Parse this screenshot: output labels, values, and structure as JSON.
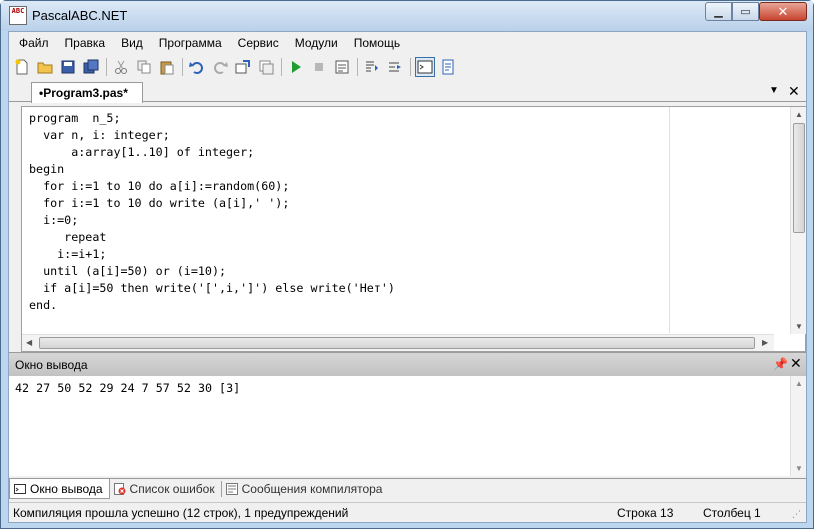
{
  "window": {
    "title": "PascalABC.NET",
    "icon_text": "ABC"
  },
  "menu": [
    "Файл",
    "Правка",
    "Вид",
    "Программа",
    "Сервис",
    "Модули",
    "Помощь"
  ],
  "toolbar": {
    "icons": [
      "new-file-icon",
      "open-folder-icon",
      "save-icon",
      "save-all-icon",
      "cut-icon",
      "copy-icon",
      "paste-icon",
      "undo-icon",
      "redo-icon",
      "find-icon",
      "replace-icon",
      "run-icon",
      "stop-icon",
      "compile-icon",
      "step-into-icon",
      "step-over-icon",
      "output-window-icon",
      "format-icon"
    ]
  },
  "editor": {
    "tab_label": "•Program3.pas*",
    "code_lines": [
      "program  n_5;",
      "  var n, i: integer;",
      "      a:array[1..10] of integer;",
      "begin",
      "  for i:=1 to 10 do a[i]:=random(60);",
      "  for i:=1 to 10 do write (a[i],' ');",
      "  i:=0;",
      "     repeat",
      "    i:=i+1;",
      "  until (a[i]=50) or (i=10);",
      "  if a[i]=50 then write('[',i,']') else write('Нет')",
      "end."
    ]
  },
  "output_panel": {
    "title": "Окно вывода",
    "text": "42 27 50 52 29 24 7 57 52 30 [3]"
  },
  "bottom_tabs": [
    "Окно вывода",
    "Список ошибок",
    "Сообщения компилятора"
  ],
  "status": {
    "message": "Компиляция прошла успешно (12 строк), 1 предупреждений",
    "row": "Строка  13",
    "col": "Столбец  1"
  }
}
